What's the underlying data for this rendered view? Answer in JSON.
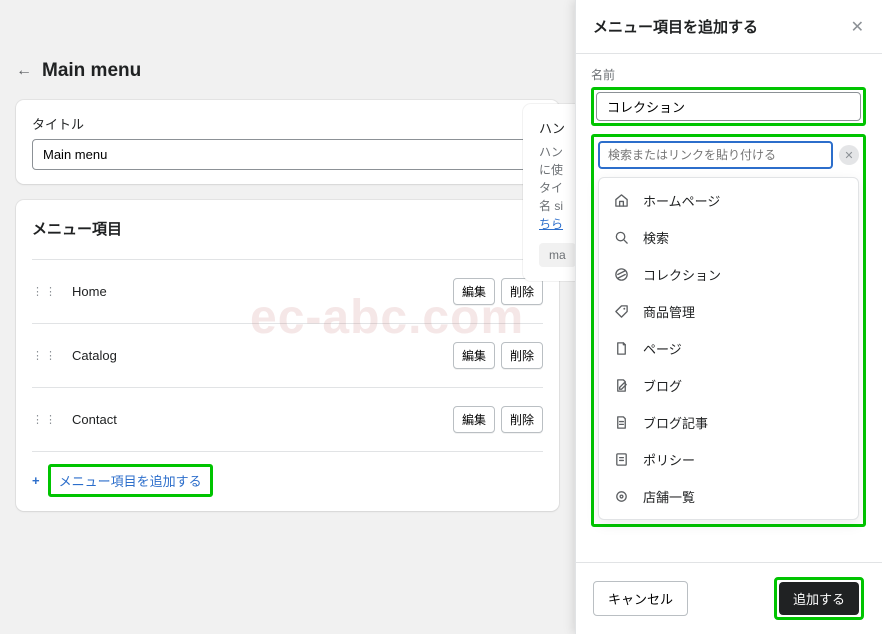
{
  "header": {
    "title": "Main menu"
  },
  "titleCard": {
    "label": "タイトル",
    "value": "Main menu"
  },
  "menuSection": {
    "title": "メニュー項目",
    "editLabel": "編集",
    "deleteLabel": "削除",
    "addLabel": "メニュー項目を追加する",
    "items": [
      {
        "name": "Home"
      },
      {
        "name": "Catalog"
      },
      {
        "name": "Contact"
      }
    ]
  },
  "handleCard": {
    "label": "ハン",
    "text1": "ハン",
    "text2": "に使",
    "text3": "タイ",
    "text4pre": "名 si",
    "linkText": "ちら",
    "badge": "ma"
  },
  "drawer": {
    "title": "メニュー項目を追加する",
    "nameLabel": "名前",
    "nameValue": "コレクション",
    "searchPlaceholder": "検索またはリンクを貼り付ける",
    "options": [
      {
        "icon": "home",
        "label": "ホームページ"
      },
      {
        "icon": "search",
        "label": "検索"
      },
      {
        "icon": "tag",
        "label": "コレクション"
      },
      {
        "icon": "price",
        "label": "商品管理"
      },
      {
        "icon": "page",
        "label": "ページ"
      },
      {
        "icon": "blog",
        "label": "ブログ"
      },
      {
        "icon": "post",
        "label": "ブログ記事"
      },
      {
        "icon": "policy",
        "label": "ポリシー"
      },
      {
        "icon": "store",
        "label": "店舗一覧"
      }
    ],
    "cancel": "キャンセル",
    "submit": "追加する"
  },
  "watermark": "ec-abc.com"
}
